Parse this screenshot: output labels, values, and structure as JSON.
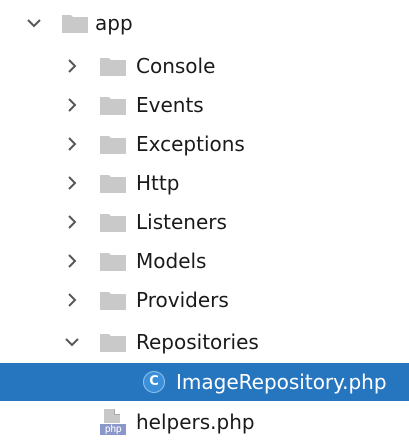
{
  "tree": {
    "root": {
      "label": "app",
      "expanded": true,
      "icon": "folder-icon"
    },
    "children": [
      {
        "label": "Console",
        "expanded": false,
        "icon": "folder-icon"
      },
      {
        "label": "Events",
        "expanded": false,
        "icon": "folder-icon"
      },
      {
        "label": "Exceptions",
        "expanded": false,
        "icon": "folder-icon"
      },
      {
        "label": "Http",
        "expanded": false,
        "icon": "folder-icon"
      },
      {
        "label": "Listeners",
        "expanded": false,
        "icon": "folder-icon"
      },
      {
        "label": "Models",
        "expanded": false,
        "icon": "folder-icon"
      },
      {
        "label": "Providers",
        "expanded": false,
        "icon": "folder-icon"
      },
      {
        "label": "Repositories",
        "expanded": true,
        "icon": "folder-icon"
      }
    ],
    "repositories_children": [
      {
        "label": "ImageRepository.php",
        "selected": true,
        "icon": "php-class-icon",
        "icon_letter": "C"
      }
    ],
    "files": [
      {
        "label": "helpers.php",
        "icon": "php-file-icon",
        "icon_tag": "php"
      }
    ]
  },
  "colors": {
    "selection": "#2675bf",
    "folder": "#c9c9c9",
    "class_icon": "#3b8fd9",
    "php_tag": "#8b96c9"
  }
}
